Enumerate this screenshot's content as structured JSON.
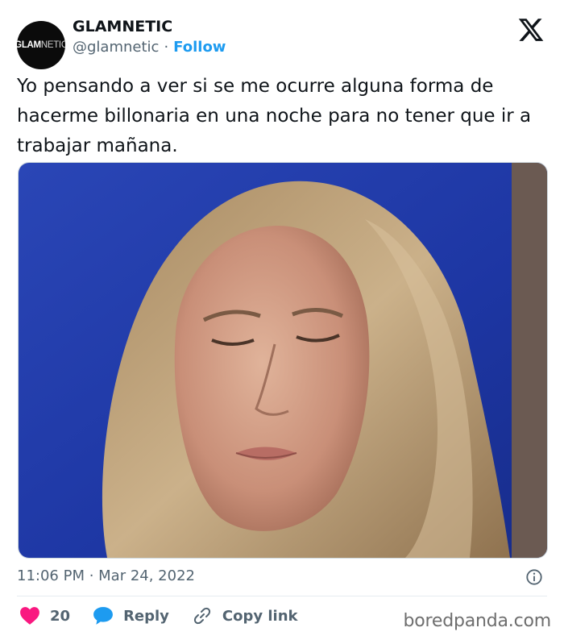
{
  "header": {
    "avatar_text_bold": "GLAM",
    "avatar_text_light": "NETIC",
    "display_name": "GLAMNETIC",
    "handle": "@glamnetic",
    "separator": "·",
    "follow_label": "Follow"
  },
  "tweet": {
    "text": "Yo pensando a ver si se me ocurre alguna forma de hacerme billonaria en una noche para no tener que ir a trabajar mañana.",
    "timestamp": "11:06 PM · Mar 24, 2022"
  },
  "actions": {
    "like_count": "20",
    "reply_label": "Reply",
    "copy_link_label": "Copy link"
  },
  "watermark": "boredpanda.com",
  "colors": {
    "accent": "#1d9bf0",
    "like": "#f91880",
    "text": "#0f1419",
    "muted": "#536471"
  },
  "icons": [
    "x-logo-icon",
    "info-icon",
    "heart-icon",
    "reply-bubble-icon",
    "link-icon"
  ]
}
